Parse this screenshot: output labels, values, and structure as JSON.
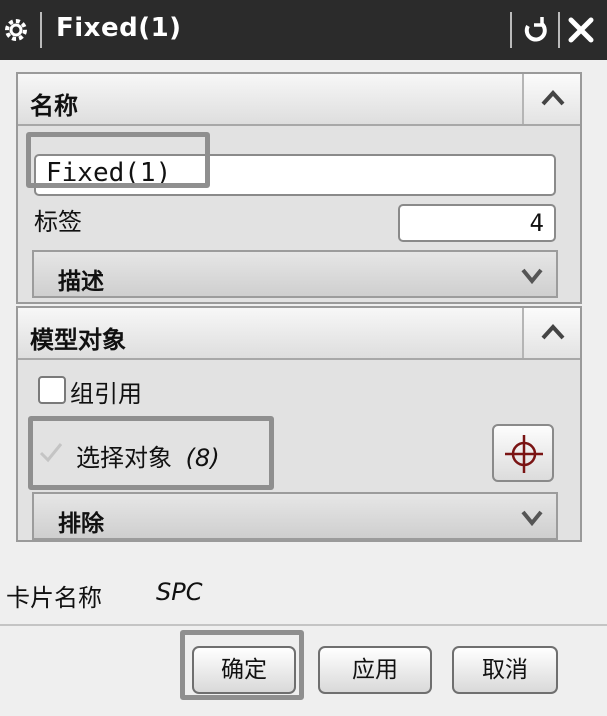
{
  "window": {
    "title": "Fixed(1)",
    "icons": {
      "app": "gear-icon",
      "reset": "reset-icon",
      "close": "close-icon"
    }
  },
  "name_group": {
    "title": "名称",
    "name_value": "Fixed(1)",
    "tag_label": "标签",
    "tag_value": "4",
    "description_label": "描述"
  },
  "model_group": {
    "title": "模型对象",
    "group_ref_label": "组引用",
    "group_ref_checked": false,
    "select_label": "选择对象",
    "select_count": "(8)",
    "exclude_label": "排除"
  },
  "card": {
    "label": "卡片名称",
    "value": "SPC"
  },
  "buttons": {
    "ok": "确定",
    "apply": "应用",
    "cancel": "取消"
  },
  "colors": {
    "title_bar": "#2b2b2b",
    "dialog_bg": "#efefef",
    "highlight_frame": "#8f8f8f"
  }
}
